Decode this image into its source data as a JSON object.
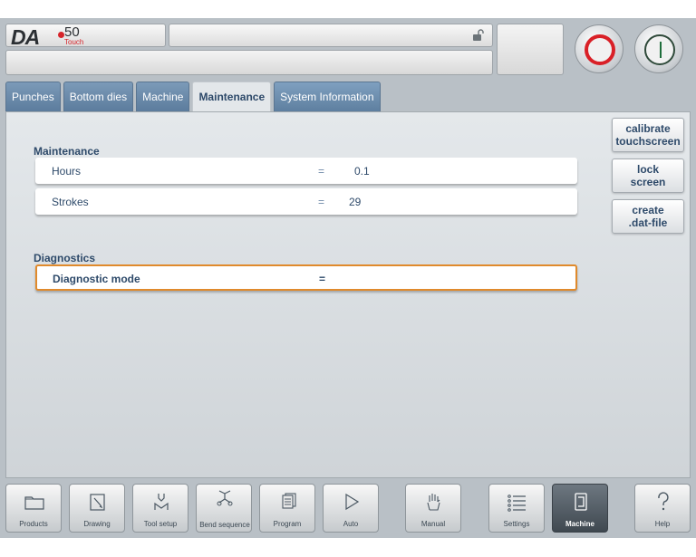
{
  "header": {
    "logo_text": "DA",
    "logo_model": "50",
    "logo_sub": "Touch",
    "icons": {
      "lock": "unlock-icon",
      "stop": "stop-icon",
      "start": "start-icon"
    },
    "colors": {
      "stop": "#d92027",
      "start": "#1f6e3c",
      "brand": "#d6242a"
    }
  },
  "tabs": [
    {
      "label": "Punches"
    },
    {
      "label": "Bottom dies"
    },
    {
      "label": "Machine"
    },
    {
      "label": "Maintenance"
    },
    {
      "label": "System Information"
    }
  ],
  "active_tab": "Maintenance",
  "maintenance": {
    "title": "Maintenance",
    "rows": [
      {
        "label": "Hours",
        "eq": "=",
        "value": "0.1"
      },
      {
        "label": "Strokes",
        "eq": "=",
        "value": "29"
      }
    ]
  },
  "diagnostics": {
    "title": "Diagnostics",
    "row": {
      "label": "Diagnostic mode",
      "eq": "=",
      "value": ""
    },
    "highlight_color": "#e08a2c"
  },
  "side_buttons": [
    {
      "line1": "calibrate",
      "line2": "touchscreen"
    },
    {
      "line1": "lock",
      "line2": "screen"
    },
    {
      "line1": "create",
      "line2": ".dat-file"
    }
  ],
  "bottom_nav": [
    {
      "label": "Products",
      "icon": "folder-icon"
    },
    {
      "label": "Drawing",
      "icon": "pencil-icon"
    },
    {
      "label": "Tool setup",
      "icon": "tool-icon"
    },
    {
      "label": "Bend sequence",
      "icon": "bend-icon"
    },
    {
      "label": "Program",
      "icon": "pages-icon"
    },
    {
      "label": "Auto",
      "icon": "play-icon"
    },
    {
      "label": "Manual",
      "icon": "hand-icon"
    },
    {
      "label": "Settings",
      "icon": "list-icon"
    },
    {
      "label": "Machine",
      "icon": "machine-icon"
    },
    {
      "label": "Help",
      "icon": "help-icon"
    }
  ],
  "active_nav": "Machine"
}
